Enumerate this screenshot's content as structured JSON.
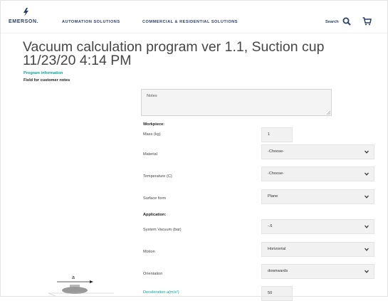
{
  "header": {
    "logo_text": "EMERSON.",
    "nav": [
      "AUTOMATION SOLUTIONS",
      "COMMERCIAL & RESIDENTIAL SOLUTIONS"
    ],
    "search_label": "Search"
  },
  "page": {
    "title": "Vacuum calculation program ver 1.1, Suction cup 11/23/20 4:14 PM",
    "program_info": "Program information",
    "customer_notes_label": "Field for customer notes",
    "notes_placeholder": "Notes"
  },
  "workpiece": {
    "heading": "Workpiece:",
    "mass_label": "Mass (kg)",
    "mass_value": "1",
    "material_label": "Material",
    "material_value": "-Choose-",
    "temperature_label": "Temperature (C)",
    "temperature_value": "-Choose-",
    "surface_label": "Surface form",
    "surface_value": "Plane"
  },
  "application": {
    "heading": "Application:",
    "vacuum_label": "System Vacuum (bar)",
    "vacuum_value": "-.6",
    "motion_label": "Motion",
    "motion_value": "Horizontal",
    "orientation_label": "Orientation",
    "orientation_value": "downwards",
    "deceleration_label": "Deceleration a(m/s²)",
    "deceleration_value": "50"
  },
  "diagram": {
    "label": "a"
  },
  "colors": {
    "brand_navy": "#2a3f67",
    "accent_teal": "#00a79b",
    "field_bg": "#f1f1f1"
  },
  "icons": [
    "emerson-logo-icon",
    "search-icon",
    "cart-icon",
    "chevron-down-icon",
    "resize-handle-icon",
    "arrow-icon"
  ]
}
